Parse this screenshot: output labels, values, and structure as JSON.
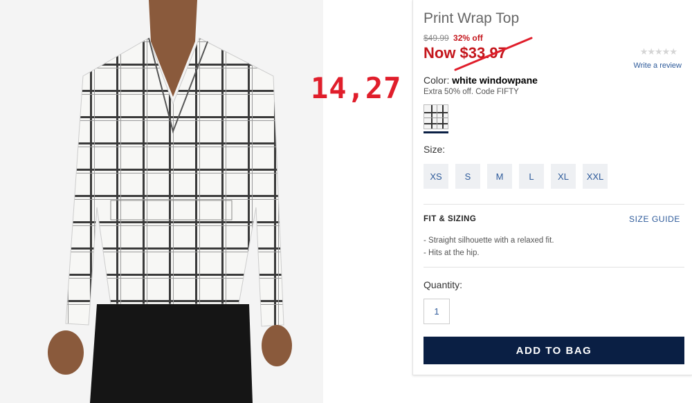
{
  "product": {
    "title": "Print Wrap Top",
    "original_price": "$49.99",
    "percent_off": "32% off",
    "now_price": "Now $33.97",
    "annotation": "14,27"
  },
  "reviews": {
    "stars": "★★★★★",
    "write_review": "Write a review"
  },
  "color": {
    "label": "Color:",
    "value": "white windowpane",
    "promo": "Extra 50% off. Code FIFTY"
  },
  "size": {
    "label": "Size:",
    "options": [
      "XS",
      "S",
      "M",
      "L",
      "XL",
      "XXL"
    ]
  },
  "fit": {
    "title": "FIT & SIZING",
    "size_guide": "SIZE GUIDE",
    "notes": [
      "- Straight silhouette with a relaxed fit.",
      "- Hits at the hip."
    ]
  },
  "quantity": {
    "label": "Quantity:",
    "value": "1"
  },
  "cta": {
    "add_to_bag": "ADD TO BAG"
  },
  "colors": {
    "sale_red": "#c4161c",
    "navy": "#0a1f44",
    "link_blue": "#2d5a9a",
    "annotation_red": "#e01e2b"
  }
}
